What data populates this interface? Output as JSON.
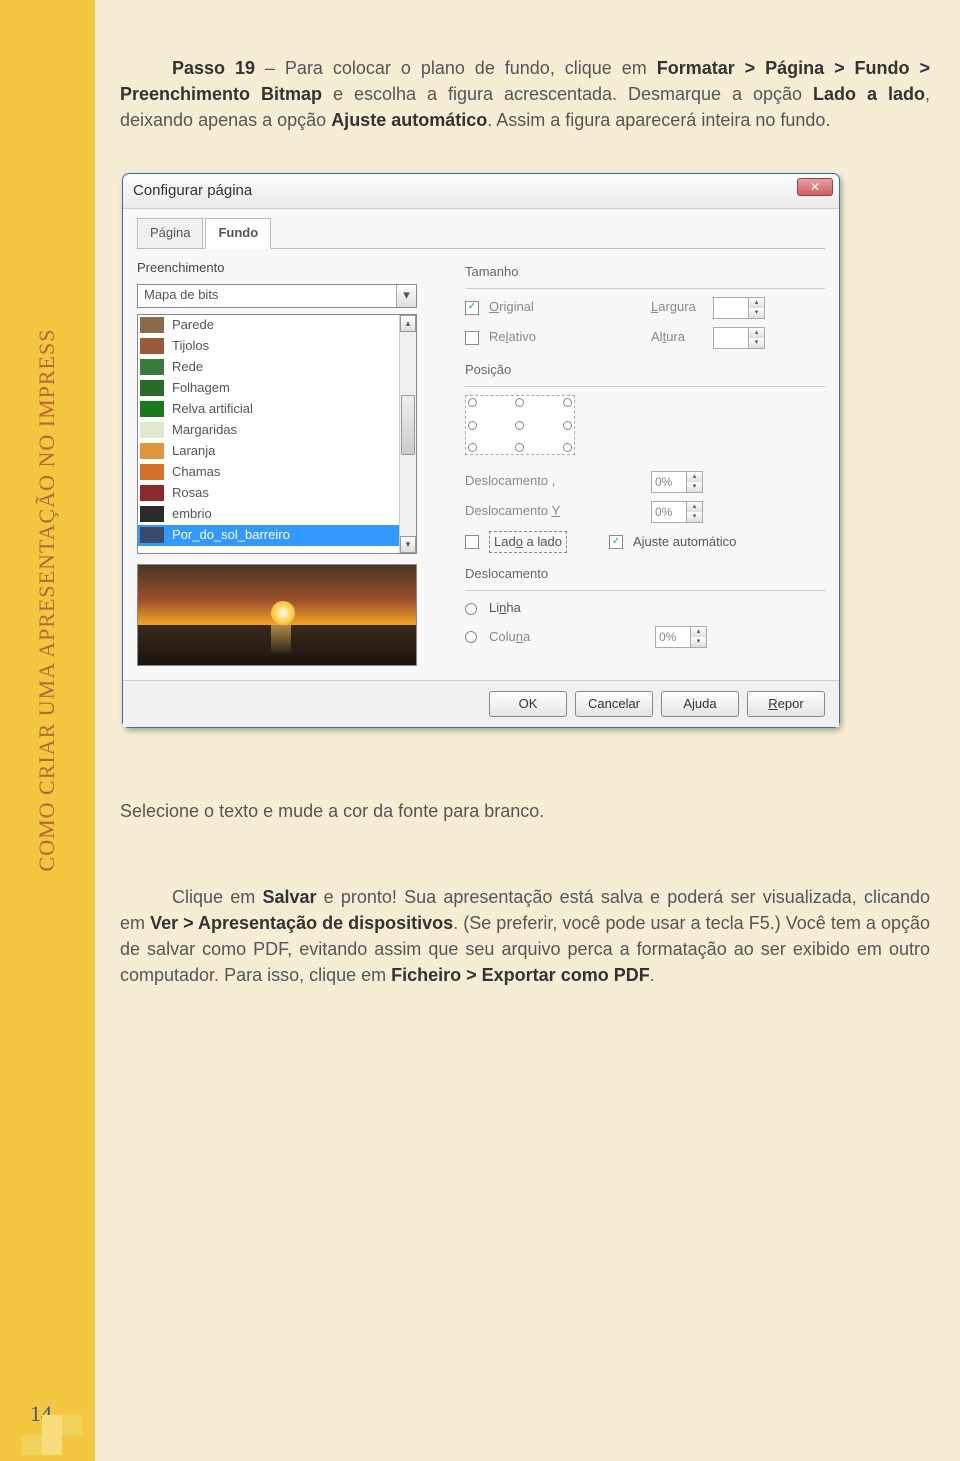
{
  "sidebar_title": "COMO CRIAR UMA APRESENTAÇÃO NO IMPRESS",
  "page_number": "14",
  "para1_a": "Passo 19",
  "para1_b": " – Para colocar o plano de fundo, clique em ",
  "para1_c": "Formatar > Página > Fundo > Preenchimento Bitmap",
  "para1_d": " e escolha a figura acrescentada. Desmarque a opção ",
  "para1_e": "Lado a lado",
  "para1_f": ", deixando apenas a opção ",
  "para1_g": "Ajuste automático",
  "para1_h": ". Assim a figura aparecerá inteira no fundo.",
  "para2": "Selecione o texto e mude a cor da fonte para branco.",
  "para3_a": "Clique em ",
  "para3_b": "Salvar",
  "para3_c": " e pronto! Sua apresentação está salva e poderá ser visualizada, clicando em ",
  "para3_d": "Ver > Apresentação de dispositivos",
  "para3_e": ". (Se preferir, você pode usar a tecla F5.) Você tem a opção de salvar como PDF, evitando assim que seu arquivo perca a formatação ao ser exibido em outro computador. Para isso, clique em ",
  "para3_f": "Ficheiro > Exportar como PDF",
  "para3_g": ".",
  "dialog": {
    "title": "Configurar página",
    "close": "✕",
    "tabs": {
      "pagina": "Página",
      "fundo": "Fundo"
    },
    "fill_label": "Preenchimento",
    "combo_value": "Mapa de bits",
    "list_items": [
      {
        "label": "Parede",
        "color": "#8a6a4a"
      },
      {
        "label": "Tijolos",
        "color": "#9a5a3a"
      },
      {
        "label": "Rede",
        "color": "#3a7a3a"
      },
      {
        "label": "Folhagem",
        "color": "#2a6a2a"
      },
      {
        "label": "Relva artificial",
        "color": "#1a7a1a"
      },
      {
        "label": "Margaridas",
        "color": "#dfe8d0"
      },
      {
        "label": "Laranja",
        "color": "#e0963c"
      },
      {
        "label": "Chamas",
        "color": "#d6702a"
      },
      {
        "label": "Rosas",
        "color": "#8a2a2a"
      },
      {
        "label": "embrio",
        "color": "#2a2a2a"
      },
      {
        "label": "Por_do_sol_barreiro",
        "color": "#3a4a6a"
      }
    ],
    "size_label": "Tamanho",
    "original": "Original",
    "relativo": "Relativo",
    "largura": "Largura",
    "altura": "Altura",
    "pos_label": "Posição",
    "desloc": "Deslocamento ,",
    "desloc_y": "Deslocamento Y",
    "lado": "Lado a lado",
    "ajuste": "Ajuste automático",
    "desloc_label": "Deslocamento",
    "linha": "Linha",
    "coluna": "Coluna",
    "pct0": "0%",
    "buttons": {
      "ok": "OK",
      "cancel": "Cancelar",
      "help": "Ajuda",
      "reset": "Repor"
    }
  }
}
